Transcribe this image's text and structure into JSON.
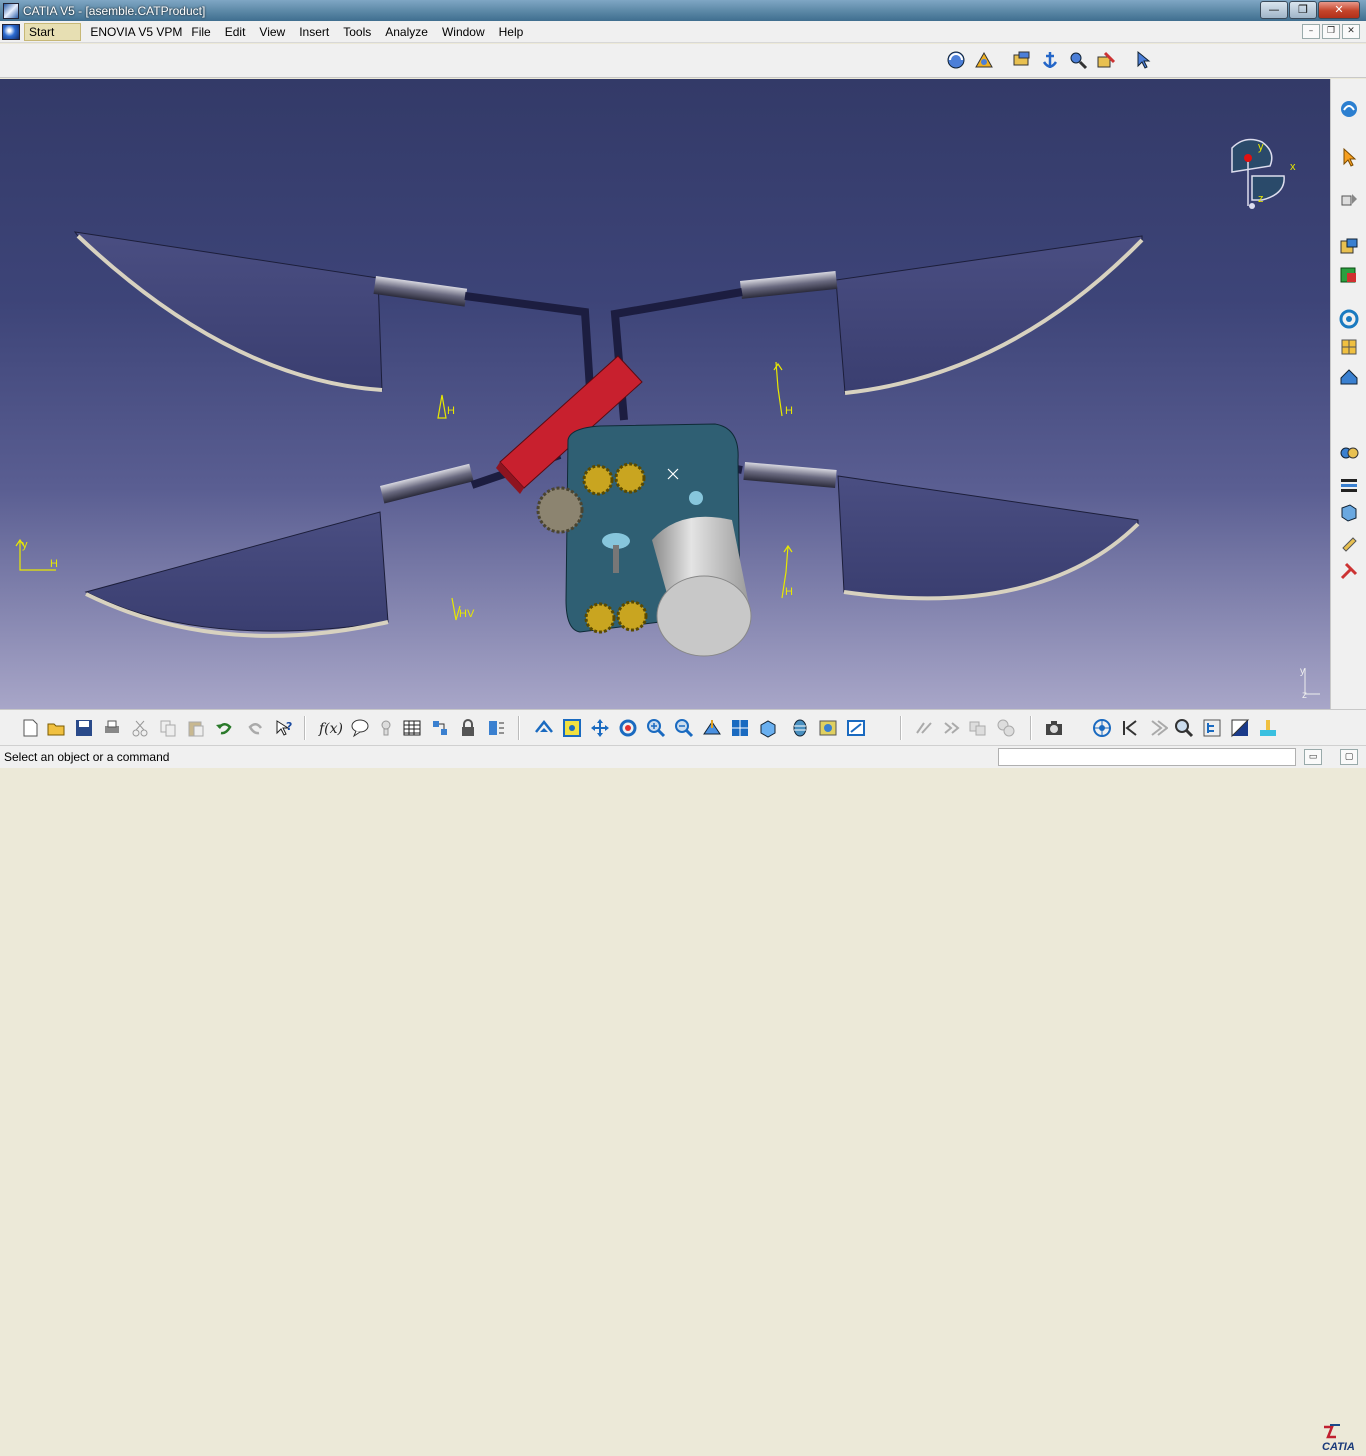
{
  "window": {
    "title": "CATIA V5 - [asemble.CATProduct]"
  },
  "menu": {
    "items": [
      "Start",
      "ENOVIA V5 VPM",
      "File",
      "Edit",
      "View",
      "Insert",
      "Tools",
      "Analyze",
      "Window",
      "Help"
    ]
  },
  "window_buttons": {
    "minimize": "—",
    "restore": "❐",
    "close": "✕"
  },
  "mdi_buttons": {
    "minimize": "–",
    "restore": "❐",
    "close": "✕"
  },
  "viewport": {
    "background_top": "#333a68",
    "background_bottom": "#a8a6c8",
    "axis_labels": {
      "x": "x",
      "y": "y",
      "z": "z"
    },
    "constraint_labels": [
      "H",
      "H",
      "H",
      "H",
      "HV"
    ],
    "axis_markers": {
      "y": "y",
      "h": "H",
      "z": "z"
    }
  },
  "top_toolbar": {
    "icons": [
      "rotate-icon",
      "fly-icon",
      "product-structure-icon",
      "anchor-icon",
      "manipulation-icon",
      "snap-icon",
      "select-icon"
    ]
  },
  "right_toolbar": {
    "icons": [
      "sketcher-icon",
      "select-arrow-icon",
      "explode-icon",
      "insert-component-icon",
      "new-part-icon",
      "reorder-icon",
      "product-icon",
      "existing-component-icon",
      "constraint-icon",
      "catalog-icon",
      "measure-icon",
      "annotation-icon",
      "tools-icon"
    ]
  },
  "bottom_toolbar": {
    "icons": [
      "new-icon",
      "open-icon",
      "save-icon",
      "print-icon",
      "cut-icon",
      "copy-icon",
      "paste-icon",
      "undo-icon",
      "redo-icon",
      "whats-this-icon",
      "formula-icon",
      "comment-icon",
      "knowledge-icon",
      "table-icon",
      "publish-icon",
      "lock-icon",
      "update-icon",
      "fly-mode-icon",
      "fit-all-icon",
      "pan-icon",
      "rotate-view-icon",
      "zoom-in-icon",
      "zoom-out-icon",
      "normal-view-icon",
      "multi-view-icon",
      "iso-view-icon",
      "render-style-icon",
      "hide-show-icon",
      "swap-space-icon",
      "analyze-icon",
      "apply-icon",
      "clash-icon",
      "section-icon",
      "camera-icon",
      "compass-icon",
      "previous-icon",
      "next-icon",
      "search-icon",
      "tree-icon",
      "color-icon",
      "material-icon"
    ]
  },
  "status": {
    "message": "Select an object or a command",
    "command_input": ""
  },
  "brand": {
    "logo_text": "CATIA"
  }
}
